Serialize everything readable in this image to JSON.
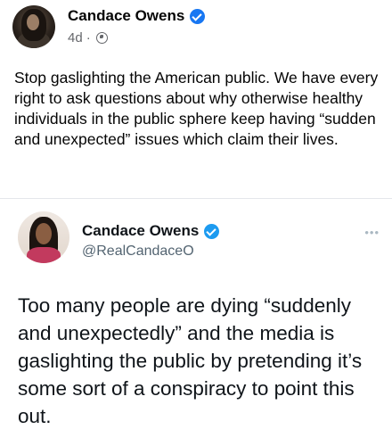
{
  "post": {
    "author": "Candace Owens",
    "timestamp": "4d",
    "separator": "·",
    "caption": "Stop gaslighting the American public. We have every right to ask questions about why otherwise healthy individuals in the public sphere keep having “sudden and unexpected” issues which claim their lives.",
    "icons": {
      "verified": "verified-badge-icon",
      "privacy": "globe-icon"
    }
  },
  "embedded_tweet": {
    "author": "Candace Owens",
    "handle": "@RealCandaceO",
    "more": "•••",
    "text": "Too many people are dying “suddenly and unexpectedly” and the media is gaslighting the public by pretending it’s some sort of a conspiracy to point this out."
  },
  "colors": {
    "facebook_blue": "#1877f2",
    "twitter_blue": "#1d9bf0",
    "secondary_text": "#65676b",
    "handle_text": "#536471"
  }
}
